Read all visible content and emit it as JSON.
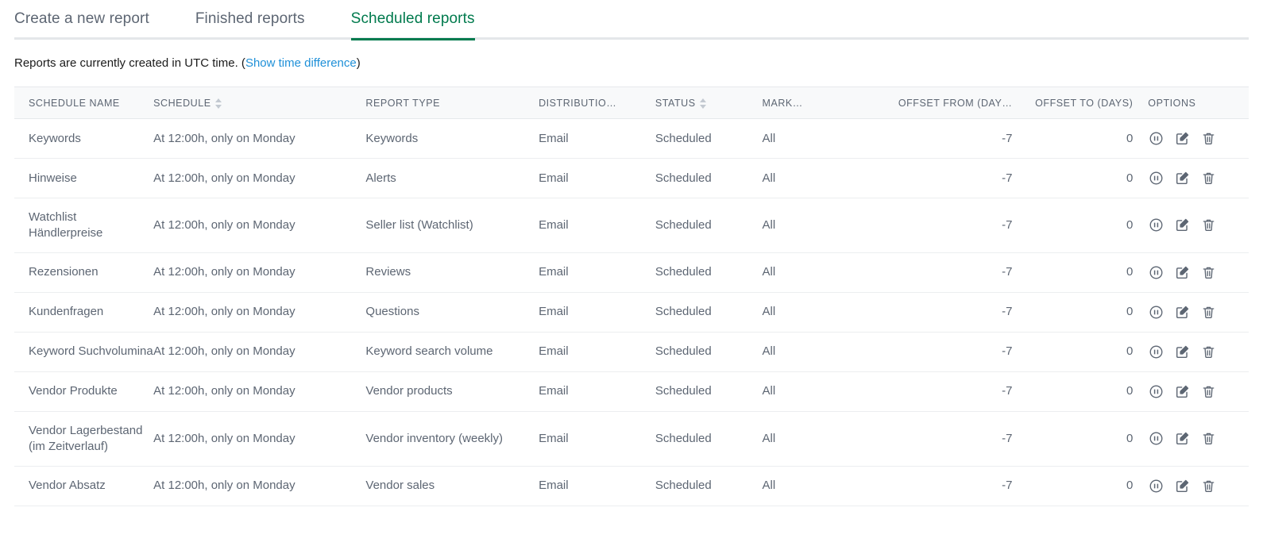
{
  "tabs": [
    {
      "label": "Create a new report",
      "active": false
    },
    {
      "label": "Finished reports",
      "active": false
    },
    {
      "label": "Scheduled reports",
      "active": true
    }
  ],
  "notice": {
    "text_before": "Reports are currently created in UTC time. (",
    "link_label": "Show time difference",
    "text_after": ")"
  },
  "colors": {
    "accent_green": "#007a4d",
    "link_blue": "#1f90d8",
    "text_gray": "#5d6673",
    "header_bg": "#f8f9fa",
    "row_border": "#eceef0"
  },
  "table": {
    "columns": [
      {
        "key": "schedule_name",
        "label": "SCHEDULE NAME",
        "sortable": false,
        "align": "left"
      },
      {
        "key": "schedule",
        "label": "SCHEDULE",
        "sortable": true,
        "align": "left"
      },
      {
        "key": "report_type",
        "label": "REPORT TYPE",
        "sortable": false,
        "align": "left"
      },
      {
        "key": "distribution",
        "label": "DISTRIBUTIO…",
        "sortable": false,
        "align": "left"
      },
      {
        "key": "status",
        "label": "STATUS",
        "sortable": true,
        "align": "left"
      },
      {
        "key": "marketplace",
        "label": "MARK…",
        "sortable": false,
        "align": "left"
      },
      {
        "key": "offset_from",
        "label": "OFFSET FROM (DAY…",
        "sortable": false,
        "align": "right"
      },
      {
        "key": "offset_to",
        "label": "OFFSET TO (DAYS)",
        "sortable": false,
        "align": "right"
      },
      {
        "key": "options",
        "label": "OPTIONS",
        "sortable": false,
        "align": "left"
      }
    ],
    "option_icons": [
      {
        "name": "pause-icon",
        "title": "Pause"
      },
      {
        "name": "edit-icon",
        "title": "Edit"
      },
      {
        "name": "delete-icon",
        "title": "Delete"
      }
    ],
    "rows": [
      {
        "schedule_name": "Keywords",
        "schedule": "At 12:00h, only on Monday",
        "report_type": "Keywords",
        "distribution": "Email",
        "status": "Scheduled",
        "marketplace": "All",
        "offset_from": "-7",
        "offset_to": "0"
      },
      {
        "schedule_name": "Hinweise",
        "schedule": "At 12:00h, only on Monday",
        "report_type": "Alerts",
        "distribution": "Email",
        "status": "Scheduled",
        "marketplace": "All",
        "offset_from": "-7",
        "offset_to": "0"
      },
      {
        "schedule_name": "Watchlist Händlerpreise",
        "schedule": "At 12:00h, only on Monday",
        "report_type": "Seller list (Watchlist)",
        "distribution": "Email",
        "status": "Scheduled",
        "marketplace": "All",
        "offset_from": "-7",
        "offset_to": "0"
      },
      {
        "schedule_name": "Rezensionen",
        "schedule": "At 12:00h, only on Monday",
        "report_type": "Reviews",
        "distribution": "Email",
        "status": "Scheduled",
        "marketplace": "All",
        "offset_from": "-7",
        "offset_to": "0"
      },
      {
        "schedule_name": "Kundenfragen",
        "schedule": "At 12:00h, only on Monday",
        "report_type": "Questions",
        "distribution": "Email",
        "status": "Scheduled",
        "marketplace": "All",
        "offset_from": "-7",
        "offset_to": "0"
      },
      {
        "schedule_name": "Keyword Suchvolumina",
        "schedule": "At 12:00h, only on Monday",
        "report_type": "Keyword search volume",
        "distribution": "Email",
        "status": "Scheduled",
        "marketplace": "All",
        "offset_from": "-7",
        "offset_to": "0"
      },
      {
        "schedule_name": "Vendor Produkte",
        "schedule": "At 12:00h, only on Monday",
        "report_type": "Vendor products",
        "distribution": "Email",
        "status": "Scheduled",
        "marketplace": "All",
        "offset_from": "-7",
        "offset_to": "0"
      },
      {
        "schedule_name": "Vendor Lagerbestand (im Zeitverlauf)",
        "schedule": "At 12:00h, only on Monday",
        "report_type": "Vendor inventory (weekly)",
        "distribution": "Email",
        "status": "Scheduled",
        "marketplace": "All",
        "offset_from": "-7",
        "offset_to": "0"
      },
      {
        "schedule_name": "Vendor Absatz",
        "schedule": "At 12:00h, only on Monday",
        "report_type": "Vendor sales",
        "distribution": "Email",
        "status": "Scheduled",
        "marketplace": "All",
        "offset_from": "-7",
        "offset_to": "0"
      }
    ]
  }
}
